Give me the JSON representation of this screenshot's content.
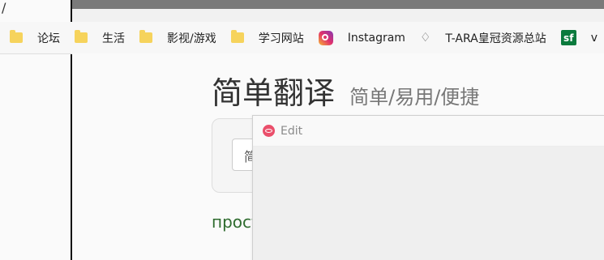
{
  "corner": {
    "slash": "/"
  },
  "bookmarks": [
    {
      "label": "论坛",
      "icon": "folder-icon"
    },
    {
      "label": "生活",
      "icon": "folder-icon"
    },
    {
      "label": "影视/游戏",
      "icon": "folder-icon"
    },
    {
      "label": "学习网站",
      "icon": "folder-icon"
    },
    {
      "label": "Instagram",
      "icon": "instagram-icon"
    },
    {
      "label": "T-ARA皇冠资源总站",
      "icon": "crown-icon"
    },
    {
      "label": "v",
      "icon": "sf-icon",
      "icon_text": "sf"
    }
  ],
  "page": {
    "title": "简单翻译",
    "subtitle": "简单/易用/便捷",
    "input_text": "简",
    "result_text": "прост"
  },
  "popup": {
    "title": "Edit",
    "icon": "eye-icon"
  },
  "colors": {
    "topbar": "#7a7a7a",
    "folder": "#f6d35c",
    "result": "#2e6b2e",
    "popup_icon": "#ea4f6b",
    "sf_icon": "#0a7a3d"
  }
}
